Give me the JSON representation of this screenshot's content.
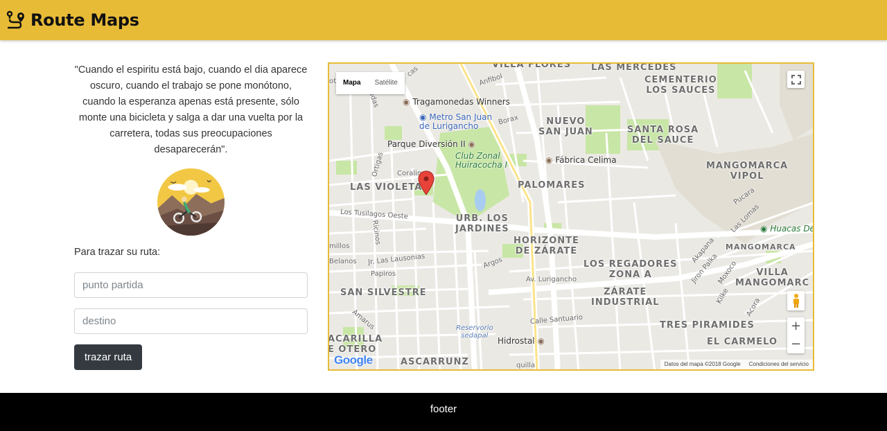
{
  "header": {
    "brand": "Route Maps",
    "brand_icon": "route-icon"
  },
  "quote": "\"Cuando el espiritu está bajo, cuando el dia aparece oscuro, cuando el trabajo se pone monótono, cuando la esperanza apenas está presente, sólo monte una bicicleta y salga a dar una vuelta por la carretera, todas sus preocupaciones desaparecerán\".",
  "form": {
    "label": "Para trazar su ruta:",
    "origin_placeholder": "punto partida",
    "destination_placeholder": "destino",
    "submit_label": "trazar ruta"
  },
  "map": {
    "type_map": "Mapa",
    "type_satellite": "Satélite",
    "zoom_in": "+",
    "zoom_out": "−",
    "attribution_data": "Datos del mapa ©2018 Google",
    "attribution_terms": "Condiciones del servicio",
    "google_logo": "Google",
    "districts": {
      "villa_flores": "VILLA FLORES",
      "las_mercedes": "LAS MERCEDES",
      "cementerio": "CEMENTERIO\nLOS SAUCES",
      "nuevo_san_juan": "NUEVO\nSAN JUAN",
      "santa_rosa": "SANTA ROSA\nDEL SAUCE",
      "mangomarca_vipol": "MANGOMARCA\nVIPOL",
      "las_violetas": "LAS VIOLETAS",
      "palomares": "PALOMARES",
      "urb_los_jardines": "URB. LOS\nJARDINES",
      "horizonte": "HORIZONTE\nDE ZÁRATE",
      "regadores": "LOS REGADORES\nZONA A",
      "zarate": "ZÁRATE\nINDUSTRIAL",
      "mangomarca": "MANGOMARCA",
      "villa_mangomarca": "VILLA\nMANGOMARC",
      "san_silvestre": "SAN SILVESTRE",
      "tres_piramides": "TRES PIRAMIDES",
      "el_carmelo": "EL CARMELO",
      "acarilla": "ACARILLA\nE OTERO",
      "ascarrunz": "ASCARRUNZ"
    },
    "pois": {
      "tragamonedas": "Tragamonedas Winners",
      "metro": "Metro San Juan\nde Lurigancho",
      "parque": "Parque Diversión II",
      "club": "Club Zonal\nHuiracocha I",
      "celima": "Fábrica Celima",
      "huacas": "Huacas De",
      "hidrostal": "Hidrostal",
      "reservorio": "Reservorio\nsedapal"
    },
    "streets": {
      "anfibol": "Anfibol",
      "borax": "Borax",
      "ortigas": "Ortigas",
      "coralina": "Coralina",
      "tusilagos": "Los Tusilagos Oeste",
      "ricinos": "Ricinos",
      "millos": "millos",
      "lausonias": "Jr. Las Lausonias",
      "belanos": "Belanos",
      "papiros": "Papiros",
      "argos": "Argos",
      "lurigancho": "Av. Lurigancho",
      "santuario": "Calle Santuario",
      "amarus": "Amarus",
      "pucara": "Pucara",
      "las_lomas": "Las Lomas",
      "akapana": "Akapana",
      "jiron_palka": "Jiron Palka",
      "moxoco": "Moxoco",
      "kilke": "Kilke",
      "acora": "Acora",
      "quilla": "quilla",
      "cas": "cas",
      "udas": "udas",
      "ot": "ot"
    }
  },
  "footer": {
    "text": "footer"
  }
}
